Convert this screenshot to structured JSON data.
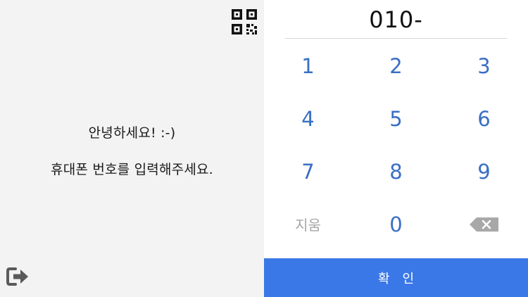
{
  "greeting": {
    "line1": "안녕하세요! :-)",
    "line2": "휴대폰 번호를 입력해주세요."
  },
  "phone": {
    "value": "010-"
  },
  "keypad": {
    "keys": [
      "1",
      "2",
      "3",
      "4",
      "5",
      "6",
      "7",
      "8",
      "9"
    ],
    "clear_label": "지움",
    "zero": "0"
  },
  "confirm": {
    "label": "확인"
  },
  "icons": {
    "qr": "qr-code-icon",
    "exit": "exit-icon",
    "backspace": "backspace-icon"
  },
  "colors": {
    "accent": "#3b78e7",
    "key_text": "#3a6fc4",
    "muted": "#a6a6a6",
    "left_bg": "#f3f3f3"
  }
}
